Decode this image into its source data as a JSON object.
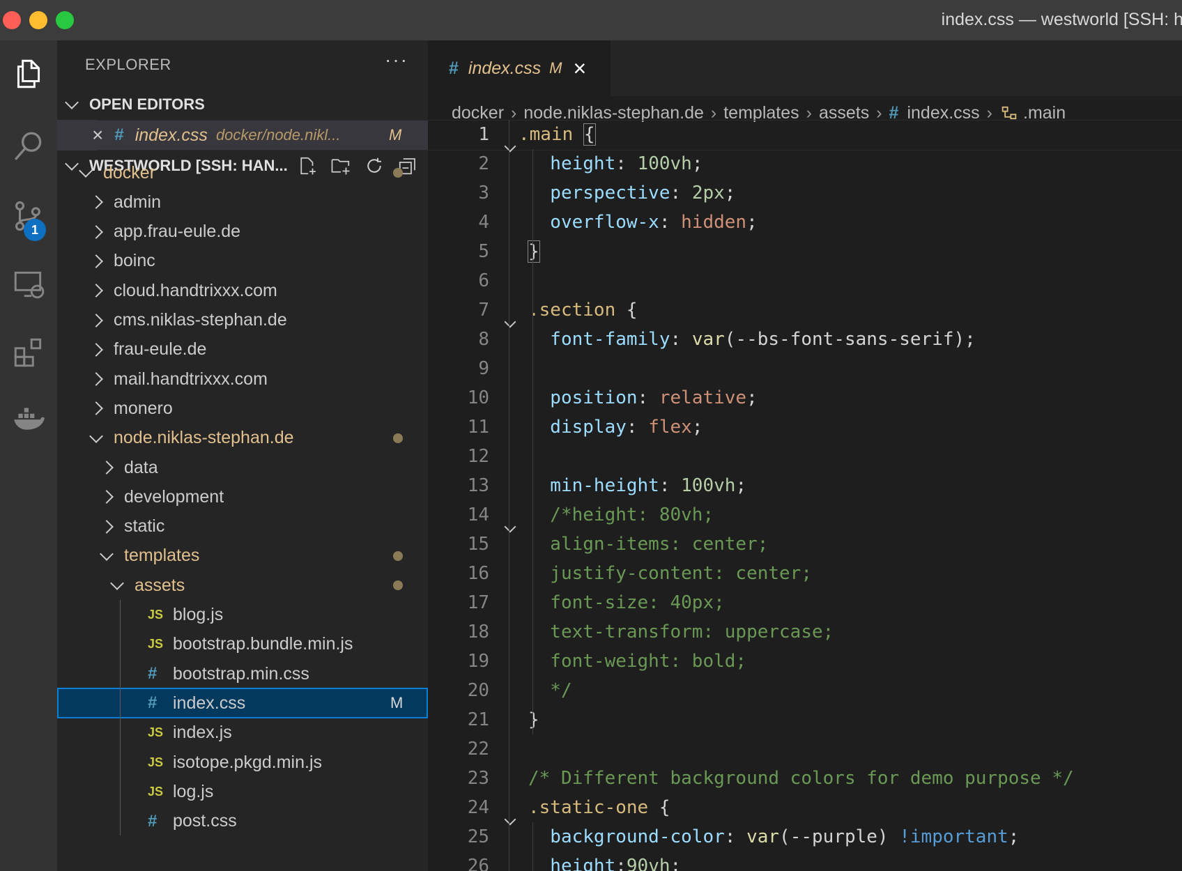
{
  "window": {
    "title": "index.css — westworld [SSH: h",
    "traffic_colors": [
      "#ff5f57",
      "#febc2e",
      "#28c840"
    ]
  },
  "activity": {
    "icons": [
      "explorer-icon",
      "search-icon",
      "source-control-icon",
      "remote-explorer-icon",
      "extensions-icon",
      "docker-icon"
    ],
    "scm_badge": "1"
  },
  "sidebar": {
    "header": "EXPLORER",
    "more": "···",
    "open_editors_title": "OPEN EDITORS",
    "open_editor": {
      "name": "index.css",
      "path": "docker/node.nikl...",
      "status": "M"
    },
    "workspace_title": "WESTWORLD [SSH: HAN...",
    "tree": [
      {
        "label": "docker",
        "type": "folder",
        "open": true,
        "modified": true
      },
      {
        "label": "admin",
        "type": "folder"
      },
      {
        "label": "app.frau-eule.de",
        "type": "folder"
      },
      {
        "label": "boinc",
        "type": "folder"
      },
      {
        "label": "cloud.handtrixxx.com",
        "type": "folder"
      },
      {
        "label": "cms.niklas-stephan.de",
        "type": "folder"
      },
      {
        "label": "frau-eule.de",
        "type": "folder"
      },
      {
        "label": "mail.handtrixxx.com",
        "type": "folder"
      },
      {
        "label": "monero",
        "type": "folder"
      },
      {
        "label": "node.niklas-stephan.de",
        "type": "folder",
        "open": true,
        "modified": true
      },
      {
        "label": "data",
        "type": "folder"
      },
      {
        "label": "development",
        "type": "folder"
      },
      {
        "label": "static",
        "type": "folder"
      },
      {
        "label": "templates",
        "type": "folder",
        "open": true,
        "modified": true
      },
      {
        "label": "assets",
        "type": "folder",
        "open": true,
        "modified": true
      },
      {
        "label": "blog.js",
        "type": "js"
      },
      {
        "label": "bootstrap.bundle.min.js",
        "type": "js"
      },
      {
        "label": "bootstrap.min.css",
        "type": "css"
      },
      {
        "label": "index.css",
        "type": "css",
        "selected": true,
        "status": "M"
      },
      {
        "label": "index.js",
        "type": "js"
      },
      {
        "label": "isotope.pkgd.min.js",
        "type": "js"
      },
      {
        "label": "log.js",
        "type": "js"
      },
      {
        "label": "post.css",
        "type": "css"
      }
    ]
  },
  "editor": {
    "tab": {
      "icon": "#",
      "name": "index.css",
      "status": "M",
      "close": "×"
    },
    "breadcrumb": [
      "docker",
      "node.niklas-stephan.de",
      "templates",
      "assets",
      "index.css",
      ".main"
    ],
    "breadcrumb_hash": "#",
    "lines": [
      {
        "n": "1",
        "fold": true,
        "tokens": [
          [
            ".main ",
            "sel"
          ],
          [
            "{",
            "brk"
          ]
        ]
      },
      {
        "n": "2",
        "tokens": [
          [
            "  height",
            "prop"
          ],
          [
            ": ",
            "p"
          ],
          [
            "100vh",
            "num"
          ],
          [
            ";",
            "p"
          ]
        ]
      },
      {
        "n": "3",
        "tokens": [
          [
            "  perspective",
            "prop"
          ],
          [
            ": ",
            "p"
          ],
          [
            "2px",
            "num"
          ],
          [
            ";",
            "p"
          ]
        ]
      },
      {
        "n": "4",
        "tokens": [
          [
            "  overflow-x",
            "prop"
          ],
          [
            ": ",
            "p"
          ],
          [
            "hidden",
            "str"
          ],
          [
            ";",
            "p"
          ]
        ]
      },
      {
        "n": "5",
        "tokens": [
          [
            "}",
            "brk"
          ]
        ]
      },
      {
        "n": "6",
        "tokens": []
      },
      {
        "n": "7",
        "fold": true,
        "tokens": [
          [
            ".section",
            "sel"
          ],
          [
            " {",
            "p"
          ]
        ]
      },
      {
        "n": "8",
        "tokens": [
          [
            "  font-family",
            "prop"
          ],
          [
            ": ",
            "p"
          ],
          [
            "var",
            "fn"
          ],
          [
            "(--bs-font-sans-serif);",
            "p"
          ]
        ]
      },
      {
        "n": "9",
        "tokens": []
      },
      {
        "n": "10",
        "tokens": [
          [
            "  position",
            "prop"
          ],
          [
            ": ",
            "p"
          ],
          [
            "relative",
            "str"
          ],
          [
            ";",
            "p"
          ]
        ]
      },
      {
        "n": "11",
        "tokens": [
          [
            "  display",
            "prop"
          ],
          [
            ": ",
            "p"
          ],
          [
            "flex",
            "str"
          ],
          [
            ";",
            "p"
          ]
        ]
      },
      {
        "n": "12",
        "tokens": []
      },
      {
        "n": "13",
        "tokens": [
          [
            "  min-height",
            "prop"
          ],
          [
            ": ",
            "p"
          ],
          [
            "100vh",
            "num"
          ],
          [
            ";",
            "p"
          ]
        ]
      },
      {
        "n": "14",
        "fold": true,
        "tokens": [
          [
            "  /*height: 80vh;",
            "com"
          ]
        ]
      },
      {
        "n": "15",
        "tokens": [
          [
            "  align-items: center;",
            "com"
          ]
        ]
      },
      {
        "n": "16",
        "tokens": [
          [
            "  justify-content: center;",
            "com"
          ]
        ]
      },
      {
        "n": "17",
        "tokens": [
          [
            "  font-size: 40px;",
            "com"
          ]
        ]
      },
      {
        "n": "18",
        "tokens": [
          [
            "  text-transform: uppercase;",
            "com"
          ]
        ]
      },
      {
        "n": "19",
        "tokens": [
          [
            "  font-weight: bold;",
            "com"
          ]
        ]
      },
      {
        "n": "20",
        "tokens": [
          [
            "  */",
            "com"
          ]
        ]
      },
      {
        "n": "21",
        "tokens": [
          [
            "}",
            "p"
          ]
        ]
      },
      {
        "n": "22",
        "tokens": []
      },
      {
        "n": "23",
        "tokens": [
          [
            "/* Different background colors for demo purpose */",
            "com"
          ]
        ]
      },
      {
        "n": "24",
        "fold": true,
        "tokens": [
          [
            ".static-one",
            "sel"
          ],
          [
            " {",
            "p"
          ]
        ]
      },
      {
        "n": "25",
        "tokens": [
          [
            "  background-color",
            "prop"
          ],
          [
            ": ",
            "p"
          ],
          [
            "var",
            "fn"
          ],
          [
            "(--purple) ",
            "p"
          ],
          [
            "!important",
            "imp"
          ],
          [
            ";",
            "p"
          ]
        ]
      },
      {
        "n": "26",
        "tokens": [
          [
            "  height",
            "prop"
          ],
          [
            ":",
            "p"
          ],
          [
            "90vh",
            "num"
          ],
          [
            ";",
            "p"
          ]
        ]
      }
    ]
  }
}
